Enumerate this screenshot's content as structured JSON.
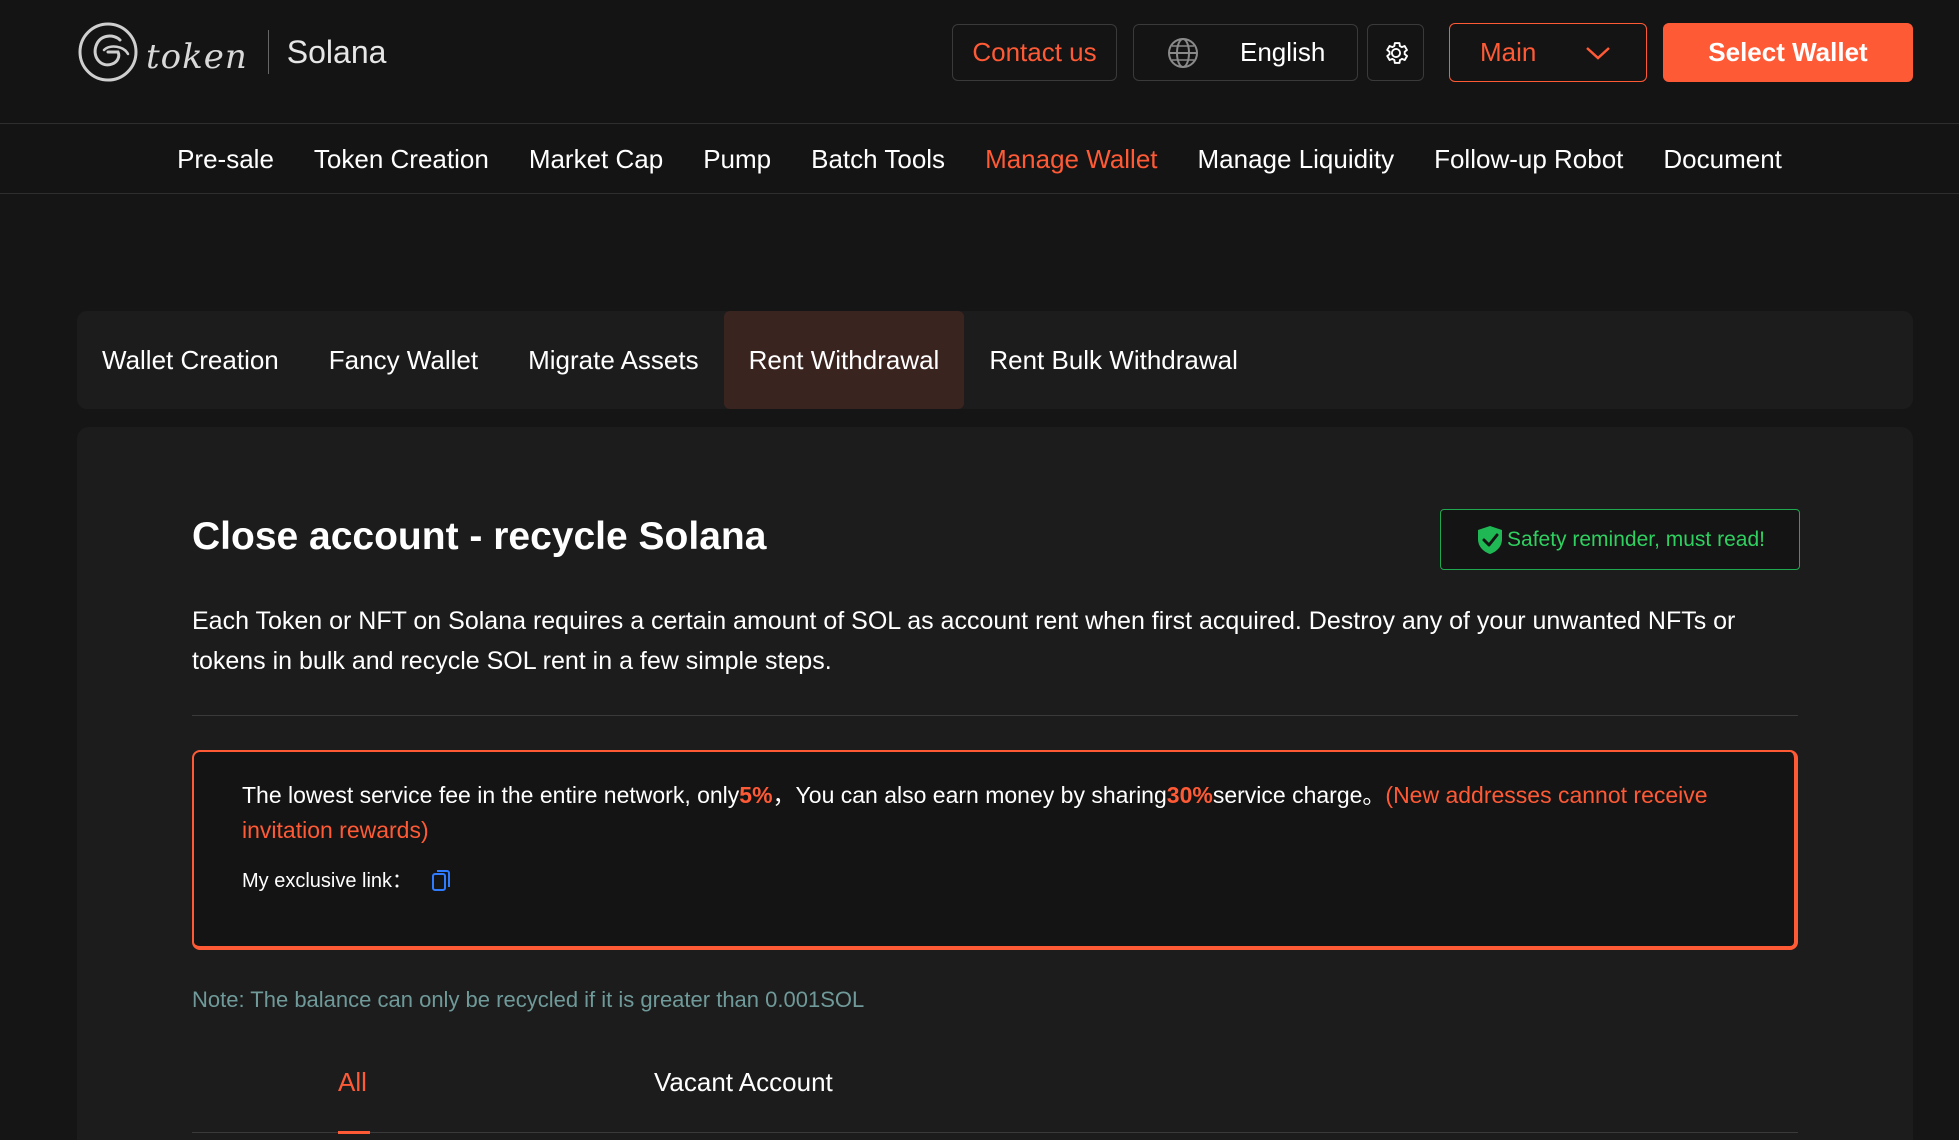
{
  "header": {
    "logo_word": "token",
    "chain": "Solana",
    "contact_label": "Contact us",
    "language": "English",
    "network": "Main",
    "wallet_label": "Select Wallet"
  },
  "nav": {
    "items": [
      {
        "label": "Pre-sale"
      },
      {
        "label": "Token Creation"
      },
      {
        "label": "Market Cap"
      },
      {
        "label": "Pump"
      },
      {
        "label": "Batch Tools"
      },
      {
        "label": "Manage Wallet",
        "active": true
      },
      {
        "label": "Manage Liquidity"
      },
      {
        "label": "Follow-up Robot"
      },
      {
        "label": "Document"
      }
    ]
  },
  "subtabs": {
    "items": [
      {
        "label": "Wallet Creation"
      },
      {
        "label": "Fancy Wallet"
      },
      {
        "label": "Migrate Assets"
      },
      {
        "label": "Rent Withdrawal",
        "active": true
      },
      {
        "label": "Rent Bulk Withdrawal"
      }
    ]
  },
  "main": {
    "title": "Close account - recycle Solana",
    "safety_label": "Safety reminder, must read!",
    "description": "Each Token or NFT on Solana requires a certain amount of SOL as account rent when first acquired. Destroy any of your unwanted NFTs or tokens in bulk and recycle SOL rent in a few simple steps.",
    "promo": {
      "text1": "The lowest service fee in the entire network, only",
      "fee": "5%",
      "text2": "，You can also earn money by sharing",
      "share": "30%",
      "text3": "service charge。",
      "warning": "(New addresses cannot receive invitation rewards)",
      "link_label": "My exclusive link："
    },
    "note": "Note: The balance can only be recycled if it is greater than 0.001SOL",
    "filter_tabs": {
      "all": "All",
      "vacant": "Vacant Account"
    }
  },
  "colors": {
    "accent": "#ff5a36",
    "success": "#2fd060",
    "background": "#151515",
    "panel": "#1c1c1c",
    "note": "#6f9a99"
  },
  "icons": [
    "logo-mark-icon",
    "globe-icon",
    "gear-icon",
    "chevron-down-icon",
    "shield-check-icon",
    "copy-icon"
  ]
}
